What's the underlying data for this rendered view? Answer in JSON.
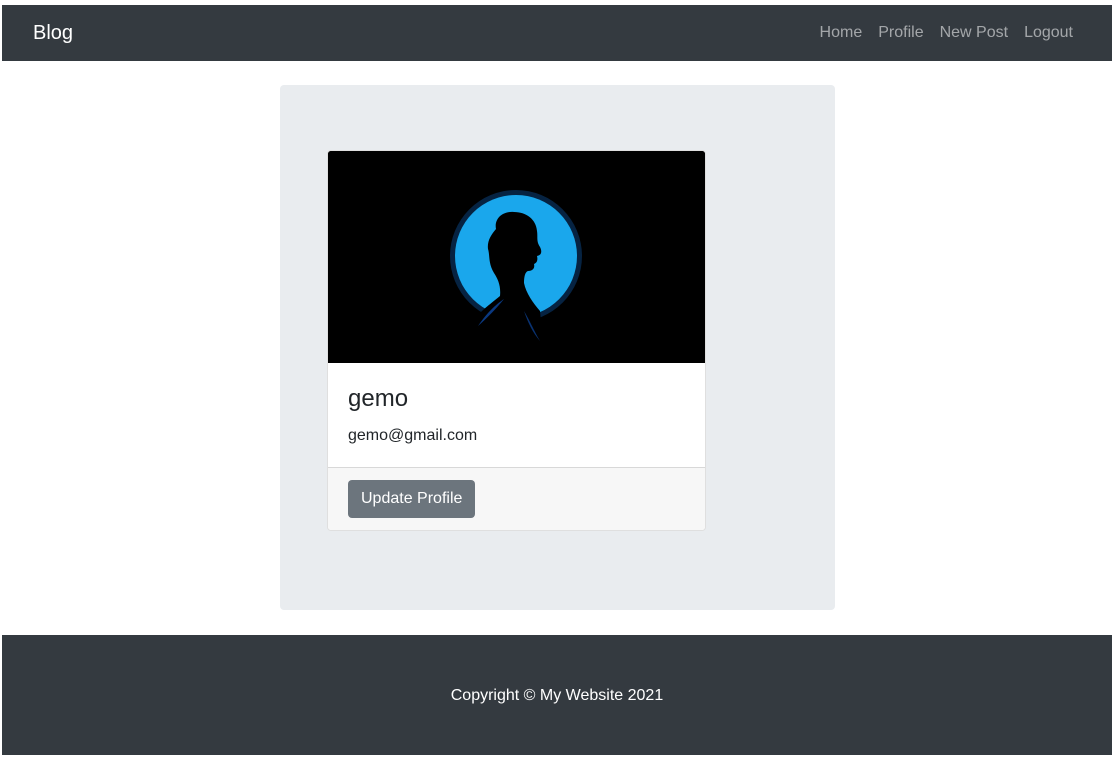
{
  "navbar": {
    "brand": "Blog",
    "links": [
      {
        "label": "Home"
      },
      {
        "label": "Profile"
      },
      {
        "label": "New Post"
      },
      {
        "label": "Logout"
      }
    ]
  },
  "profile": {
    "name": "gemo",
    "email": "gemo@gmail.com",
    "update_button_label": "Update Profile",
    "image_alt": "profile-silhouette"
  },
  "footer": {
    "copyright": "Copyright © My Website 2021"
  },
  "colors": {
    "navbar_bg": "#343a40",
    "jumbotron_bg": "#e9ecef",
    "button_bg": "#6c757d",
    "avatar_circle": "#1aa7ec"
  }
}
